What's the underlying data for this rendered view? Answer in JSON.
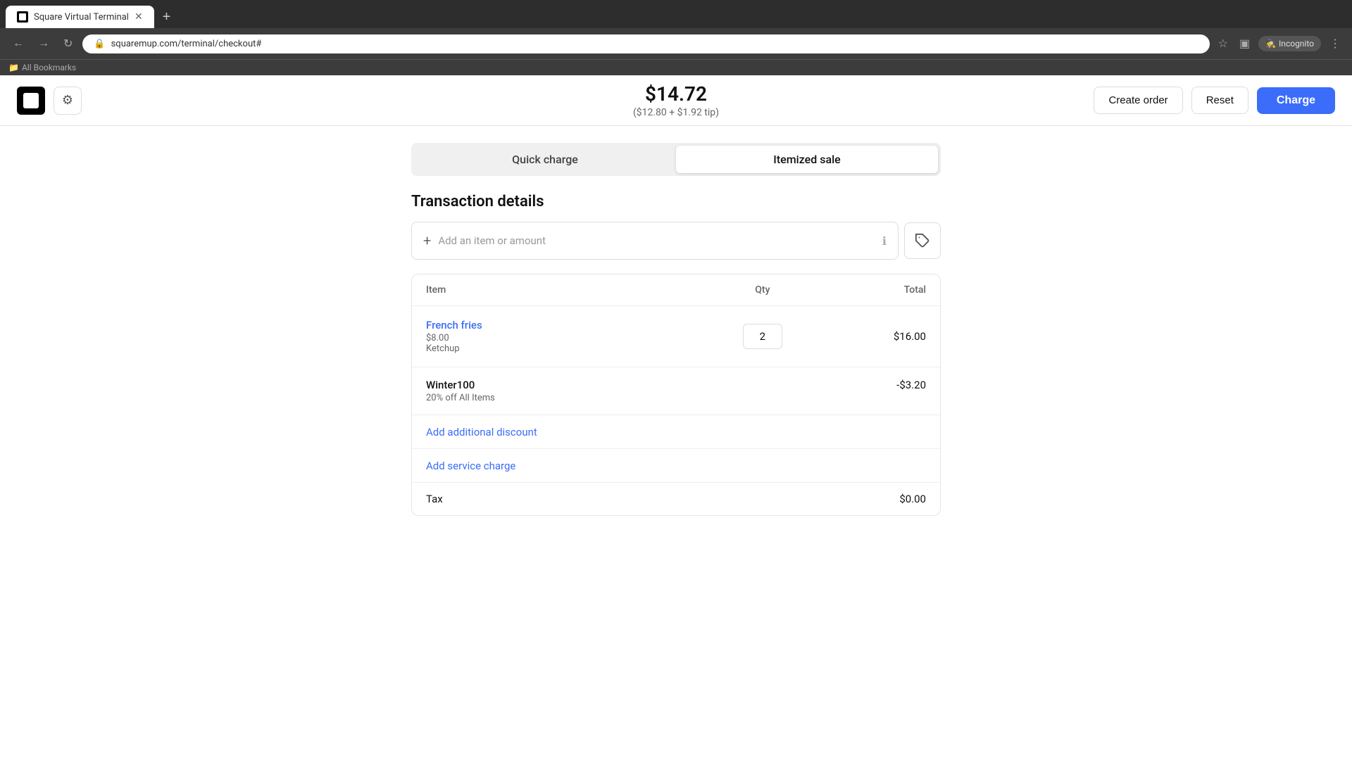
{
  "browser": {
    "tab_title": "Square Virtual Terminal",
    "url": "squaremup.com/terminal/checkout#",
    "incognito_label": "Incognito",
    "bookmarks_label": "All Bookmarks",
    "new_tab_symbol": "+"
  },
  "header": {
    "amount": "$14.72",
    "amount_sub": "($12.80 + $1.92 tip)",
    "create_order_label": "Create order",
    "reset_label": "Reset",
    "charge_label": "Charge"
  },
  "tabs": {
    "quick_charge": "Quick charge",
    "itemized_sale": "Itemized sale",
    "active": "itemized_sale"
  },
  "transaction": {
    "section_title": "Transaction details",
    "add_item_placeholder": "Add an item or amount",
    "table": {
      "col_item": "Item",
      "col_qty": "Qty",
      "col_total": "Total"
    },
    "items": [
      {
        "name": "French fries",
        "price": "$8.00",
        "modifier": "Ketchup",
        "qty": "2",
        "total": "$16.00"
      }
    ],
    "discount": {
      "name": "Winter100",
      "description": "20% off All Items",
      "amount": "-$3.20"
    },
    "add_discount_label": "Add additional discount",
    "add_service_label": "Add service charge",
    "tax": {
      "label": "Tax",
      "amount": "$0.00"
    }
  },
  "colors": {
    "blue": "#3b6dfa",
    "border": "#e5e5e5",
    "text_primary": "#111",
    "text_secondary": "#666",
    "tab_bg": "#f0f0f0"
  }
}
